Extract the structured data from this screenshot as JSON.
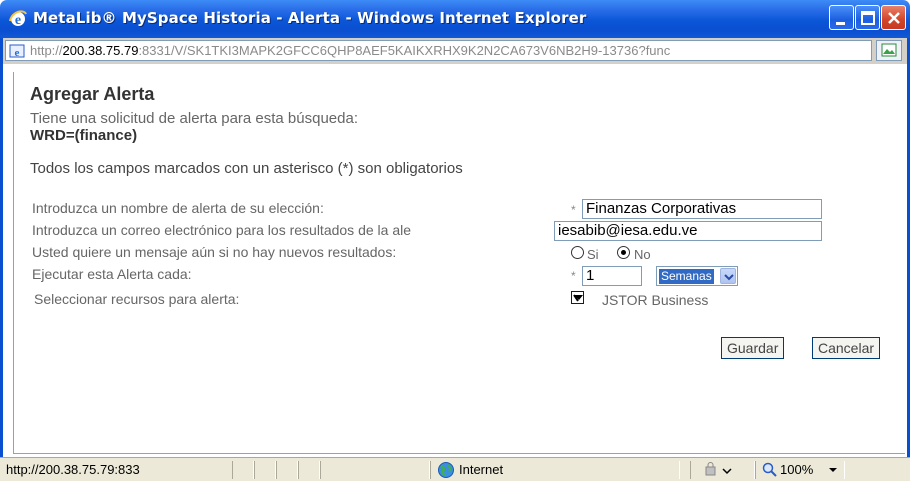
{
  "window": {
    "title": "MetaLib® MySpace Historia - Alerta - Windows Internet Explorer"
  },
  "address_bar": {
    "url_prefix": "http://",
    "url_host": "200.38.75.79",
    "url_rest": ":8331/V/SK1TKI3MAPK2GFCC6QHP8AEF5KAIKXRHX9K2N2CA673V6NB2H9-13736?func"
  },
  "page": {
    "heading": "Agregar Alerta",
    "request_text": "Tiene una solicitud de alerta para esta búsqueda:",
    "query": "WRD=(finance)",
    "required_note": "Todos los campos marcados con un asterisco (*) son obligatorios"
  },
  "form": {
    "name_label": "Introduzca un nombre de alerta de su elección:",
    "name_value": "Finanzas Corporativas",
    "email_label": "Introduzca un correo electrónico para los resultados de la ale",
    "email_value": "iesabib@iesa.edu.ve",
    "message_label": "Usted quiere un mensaje aún si no hay nuevos resultados:",
    "radio_si": "Si",
    "radio_no": "No",
    "radio_selected": "No",
    "frequency_label": "Ejecutar esta Alerta cada:",
    "frequency_value": "1",
    "frequency_unit": "Semanas",
    "resources_label": "Seleccionar recursos para alerta:",
    "resource_name": "JSTOR Business",
    "resource_checked": true,
    "asterisk": "*",
    "save_label": "Guardar",
    "cancel_label": "Cancelar"
  },
  "status_bar": {
    "url": "http://200.38.75.79:833",
    "zone": "Internet",
    "zoom": "100%"
  }
}
